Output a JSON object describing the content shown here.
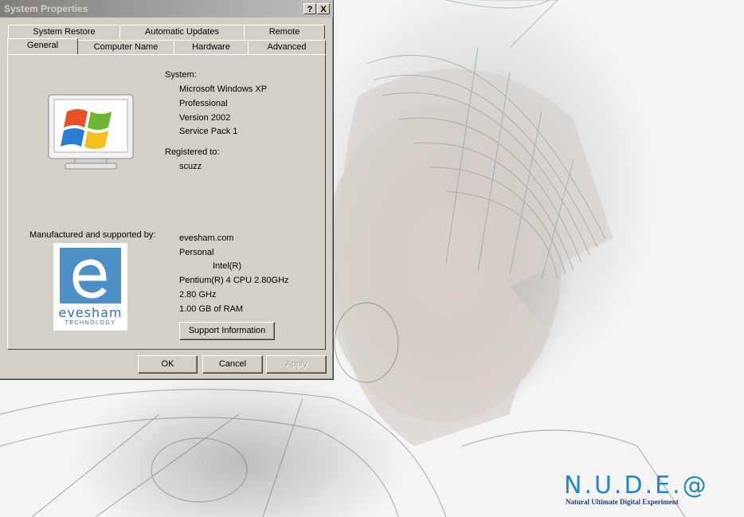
{
  "window": {
    "title": "System Properties",
    "help_button": "?",
    "close_button": "X"
  },
  "tabs": {
    "row1": [
      "System Restore",
      "Automatic Updates",
      "Remote"
    ],
    "row2": [
      "General",
      "Computer Name",
      "Hardware",
      "Advanced"
    ],
    "active": "General"
  },
  "system": {
    "heading": "System:",
    "os_name": "Microsoft Windows XP",
    "edition": "Professional",
    "version": "Version 2002",
    "service_pack": "Service Pack 1"
  },
  "registration": {
    "heading": "Registered to:",
    "user": "scuzz"
  },
  "manufacturer": {
    "heading": "Manufactured and supported by:",
    "logo_name": "evesham",
    "logo_sub": "TECHNOLOGY",
    "name": "evesham.com",
    "model": "Personal",
    "cpu_vendor": "Intel(R)",
    "cpu_model": "Pentium(R) 4 CPU 2.80GHz",
    "cpu_speed": "2.80 GHz",
    "ram": "1.00 GB of RAM",
    "support_button": "Support Information"
  },
  "buttons": {
    "ok": "OK",
    "cancel": "Cancel",
    "apply": "Apply"
  },
  "wallpaper": {
    "brand": "N.U.D.E.@",
    "tagline": "Natural Ultimate Digital Experiment",
    "brand_color": "#1f86c8"
  }
}
